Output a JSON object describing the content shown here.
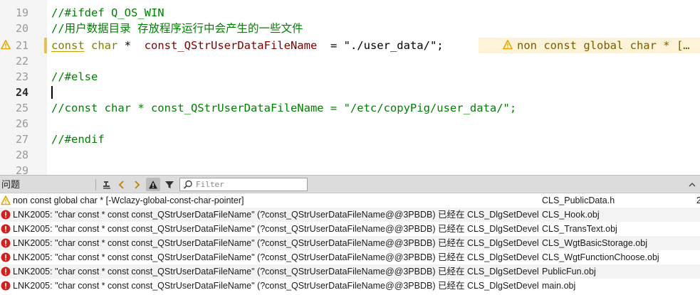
{
  "editor": {
    "lines": [
      {
        "number": "19",
        "text": "//#ifdef Q_OS_WIN"
      },
      {
        "number": "20",
        "text": "//用户数据目录 存放程序运行中会产生的一些文件"
      },
      {
        "number": "21",
        "kw": "const",
        "type": "char",
        "ptr": " *  ",
        "var": "const_QStrUserDataFileName",
        "rest": "  = \"./user_data/\";"
      },
      {
        "number": "22",
        "text": ""
      },
      {
        "number": "23",
        "text": "//#else"
      },
      {
        "number": "24",
        "text": ""
      },
      {
        "number": "25",
        "text": "//const char * const_QStrUserDataFileName = \"/etc/copyPig/user_data/\";"
      },
      {
        "number": "26",
        "text": ""
      },
      {
        "number": "27",
        "text": "//#endif"
      },
      {
        "number": "28",
        "text": ""
      },
      {
        "number": "29",
        "text": ""
      }
    ],
    "inline_warning": "non const global char * […"
  },
  "issues_panel": {
    "title": "问题",
    "filter_placeholder": "Filter",
    "rows": [
      {
        "type": "warning",
        "message": "non const global char * [-Wclazy-global-const-char-pointer]",
        "file": "CLS_PublicData.h",
        "line": "2"
      },
      {
        "type": "error",
        "message": "LNK2005: \"char const * const const_QStrUserDataFileName\" (?const_QStrUserDataFileName@@3PBDB) 已经在 CLS_DlgSetDevel",
        "file": "CLS_Hook.obj",
        "line": ""
      },
      {
        "type": "error",
        "message": "LNK2005: \"char const * const const_QStrUserDataFileName\" (?const_QStrUserDataFileName@@3PBDB) 已经在 CLS_DlgSetDevel",
        "file": "CLS_TransText.obj",
        "line": ""
      },
      {
        "type": "error",
        "message": "LNK2005: \"char const * const const_QStrUserDataFileName\" (?const_QStrUserDataFileName@@3PBDB) 已经在 CLS_DlgSetDevel",
        "file": "CLS_WgtBasicStorage.obj",
        "line": ""
      },
      {
        "type": "error",
        "message": "LNK2005: \"char const * const const_QStrUserDataFileName\" (?const_QStrUserDataFileName@@3PBDB) 已经在 CLS_DlgSetDevel",
        "file": "CLS_WgtFunctionChoose.obj",
        "line": ""
      },
      {
        "type": "error",
        "message": "LNK2005: \"char const * const const_QStrUserDataFileName\" (?const_QStrUserDataFileName@@3PBDB) 已经在 CLS_DlgSetDevel",
        "file": "PublicFun.obj",
        "line": ""
      },
      {
        "type": "error",
        "message": "LNK2005: \"char const * const const_QStrUserDataFileName\" (?const_QStrUserDataFileName@@3PBDB) 已经在 CLS_DlgSetDevel",
        "file": "main.obj",
        "line": ""
      }
    ]
  },
  "colors": {
    "comment": "#008000",
    "keyword": "#808000",
    "variable": "#800000",
    "warning": "#e6a800",
    "error": "#d02020"
  }
}
